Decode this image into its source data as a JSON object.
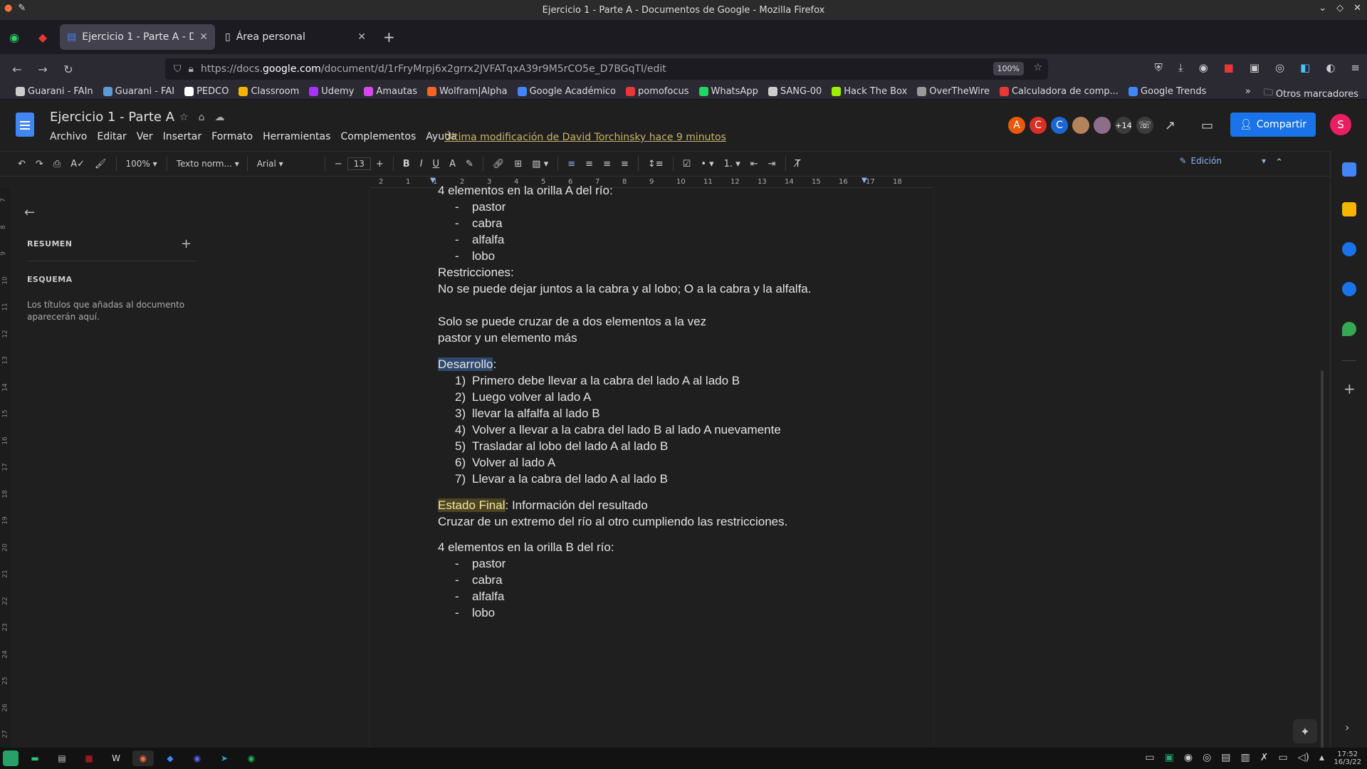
{
  "window": {
    "title": "Ejercicio 1 - Parte A - Documentos de Google - Mozilla Firefox"
  },
  "tabs": [
    {
      "label": "Ejercicio 1 - Parte A - Docum",
      "active": true
    },
    {
      "label": "Área personal",
      "active": false
    }
  ],
  "nav": {
    "url_prefix": "https://docs.",
    "url_domain": "google.com",
    "url_suffix": "/document/d/1rFryMrpj6x2grrx2JVFATqxA39r9M5rCO5e_D7BGqTI/edit",
    "zoom": "100%"
  },
  "bookmarks": [
    {
      "label": "Guarani - FAIn",
      "color": "#cccccc"
    },
    {
      "label": "Guarani - FAI",
      "color": "#5b9bd5"
    },
    {
      "label": "PEDCO",
      "color": "#ffffff"
    },
    {
      "label": "Classroom",
      "color": "#f4b400"
    },
    {
      "label": "Udemy",
      "color": "#a435f0"
    },
    {
      "label": "Amautas",
      "color": "#d946ef"
    },
    {
      "label": "Wolfram|Alpha",
      "color": "#f26522"
    },
    {
      "label": "Google Académico",
      "color": "#4285f4"
    },
    {
      "label": "pomofocus",
      "color": "#e53935"
    },
    {
      "label": "WhatsApp",
      "color": "#25d366"
    },
    {
      "label": "SANG-00",
      "color": "#cccccc"
    },
    {
      "label": "Hack The Box",
      "color": "#9fef00"
    },
    {
      "label": "OverTheWire",
      "color": "#999999"
    },
    {
      "label": "Calculadora de comp...",
      "color": "#e53935"
    },
    {
      "label": "Google Trends",
      "color": "#4285f4"
    }
  ],
  "bookmarks_other": "Otros marcadores",
  "doc": {
    "title": "Ejercicio 1 - Parte A",
    "menus": [
      "Archivo",
      "Editar",
      "Ver",
      "Insertar",
      "Formato",
      "Herramientas",
      "Complementos",
      "Ayuda"
    ],
    "last_modified": "Última modificación de David Torchinsky hace 9 minutos",
    "share_label": "Compartir",
    "user_initial": "S",
    "collaborators": [
      {
        "initial": "A",
        "color": "#e8590c"
      },
      {
        "initial": "C",
        "color": "#d93025"
      },
      {
        "initial": "C",
        "color": "#1967d2"
      },
      {
        "initial": "",
        "color": "#b5835a"
      },
      {
        "initial": "",
        "color": "#8e6d8a"
      }
    ],
    "more_collaborators": "+14"
  },
  "toolbar": {
    "zoom": "100%",
    "style": "Texto norm...",
    "font": "Arial",
    "font_size": "13",
    "mode": "Edición"
  },
  "ruler": [
    "2",
    "1",
    "1",
    "2",
    "3",
    "4",
    "5",
    "6",
    "7",
    "8",
    "9",
    "10",
    "11",
    "12",
    "13",
    "14",
    "15",
    "16",
    "17",
    "18"
  ],
  "vruler": [
    "7",
    "8",
    "9",
    "10",
    "11",
    "12",
    "13",
    "14",
    "15",
    "16",
    "17",
    "18",
    "19",
    "20",
    "21",
    "22",
    "23",
    "24",
    "25",
    "26",
    "27"
  ],
  "outline": {
    "summary": "RESUMEN",
    "schema": "ESQUEMA",
    "hint": "Los títulos que añadas al documento aparecerán aquí."
  },
  "content": {
    "orilla_a": "4 elementos en la orilla A del río:",
    "items_a": [
      "pastor",
      "cabra",
      "alfalfa",
      "lobo"
    ],
    "restr_title": "Restricciones:",
    "restr_1": "No se puede dejar juntos a la cabra y al lobo; O a la cabra y la alfalfa.",
    "restr_2": "Solo se puede cruzar de a dos elementos a la vez",
    "restr_3": "pastor y un elemento más",
    "dev_title": "Desarrollo",
    "dev_colon": ":",
    "steps": [
      "Primero debe llevar a la cabra del lado A al lado B",
      " Luego volver al lado A",
      "llevar la alfalfa al lado B",
      "Volver a llevar a la cabra del lado B al lado A nuevamente",
      "Trasladar al lobo del lado A al lado B",
      "Volver al lado A",
      "Llevar a la cabra del lado A al lado B"
    ],
    "final_title": "Estado Final",
    "final_rest": ": Información del resultado",
    "final_desc": "Cruzar de un extremo del río al otro cumpliendo las restricciones.",
    "orilla_b": "4 elementos en la orilla B del río:",
    "items_b": [
      "pastor",
      "cabra",
      "alfalfa",
      "lobo"
    ]
  },
  "clock": {
    "time": "17:52",
    "date": "16/3/22"
  }
}
